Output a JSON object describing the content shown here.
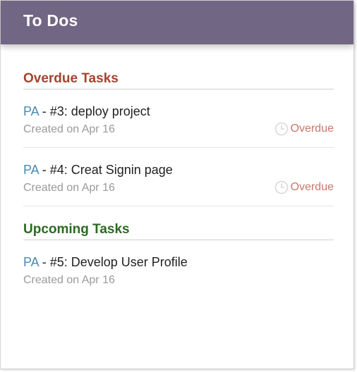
{
  "header": {
    "title": "To Dos"
  },
  "overdue": {
    "title": "Overdue Tasks",
    "tasks": [
      {
        "project": "PA",
        "separator": " - ",
        "name": "#3: deploy project",
        "created": "Created on Apr 16",
        "status": "Overdue"
      },
      {
        "project": "PA",
        "separator": " - ",
        "name": "#4: Creat Signin page",
        "created": "Created on Apr 16",
        "status": "Overdue"
      }
    ]
  },
  "upcoming": {
    "title": "Upcoming Tasks",
    "tasks": [
      {
        "project": "PA",
        "separator": " - ",
        "name": "#5: Develop User Profile",
        "created": "Created on Apr 16"
      }
    ]
  },
  "colors": {
    "header_bg": "#726685",
    "overdue_title": "#a5432e",
    "upcoming_title": "#2a6a21",
    "project_link": "#4a8ab0",
    "overdue_status": "#c9776a"
  },
  "icons": {
    "status": "clock-icon"
  }
}
